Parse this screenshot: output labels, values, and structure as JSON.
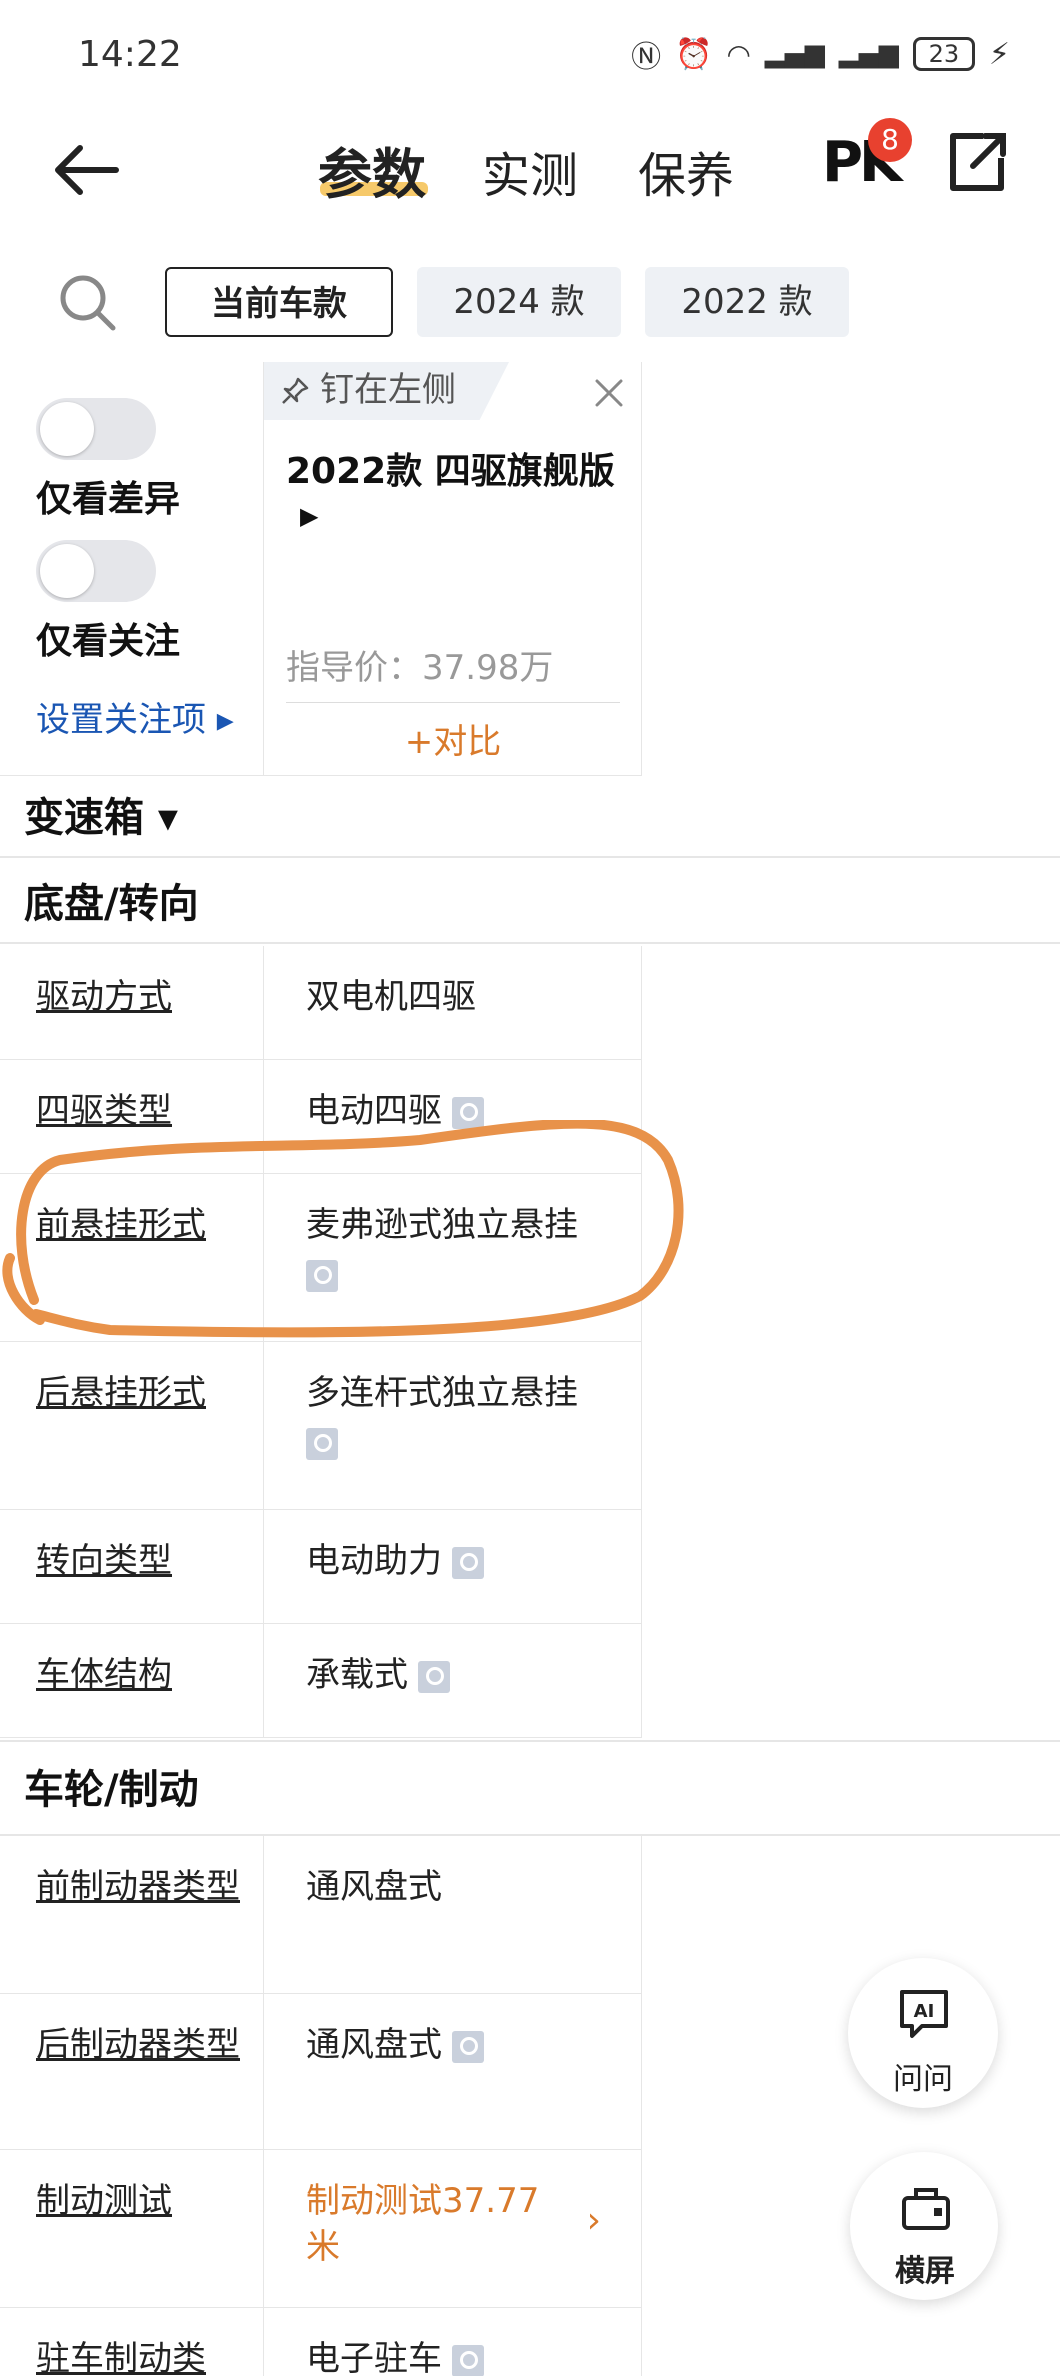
{
  "status": {
    "time": "14:22",
    "battery": "23"
  },
  "nav": {
    "tabs": [
      "参数",
      "实测",
      "保养"
    ],
    "pk_label": "PK",
    "pk_badge": "8"
  },
  "filters": [
    "当前车款",
    "2024 款",
    "2022 款"
  ],
  "left_panel": {
    "toggle1": "仅看差异",
    "toggle2": "仅看关注",
    "set_attention": "设置关注项 ▸"
  },
  "car": {
    "pin_label": "钉在左侧",
    "name": "2022款 四驱旗舰版",
    "price": "指导价：37.98万",
    "compare": "+对比"
  },
  "sections": {
    "gearbox": "变速箱 ▾",
    "chassis": "底盘/转向",
    "wheels": "车轮/制动"
  },
  "chassis_rows": [
    {
      "label": "驱动方式",
      "value": "双电机四驱"
    },
    {
      "label": "四驱类型",
      "value": "电动四驱"
    },
    {
      "label": "前悬挂形式",
      "value": "麦弗逊式独立悬挂"
    },
    {
      "label": "后悬挂形式",
      "value": "多连杆式独立悬挂"
    },
    {
      "label": "转向类型",
      "value": "电动助力"
    },
    {
      "label": "车体结构",
      "value": "承载式"
    }
  ],
  "wheel_rows": [
    {
      "label": "前制动器类型",
      "value": "通风盘式"
    },
    {
      "label": "后制动器类型",
      "value": "通风盘式"
    },
    {
      "label": "制动测试",
      "value": "制动测试37.77米"
    },
    {
      "label": "驻车制动类",
      "value": "电子驻车"
    }
  ],
  "fabs": {
    "ai": "问问",
    "landscape": "横屏"
  },
  "colors": {
    "accent_orange": "#d97a2b",
    "link_blue": "#1a56b3",
    "annotation": "#e8924a"
  }
}
